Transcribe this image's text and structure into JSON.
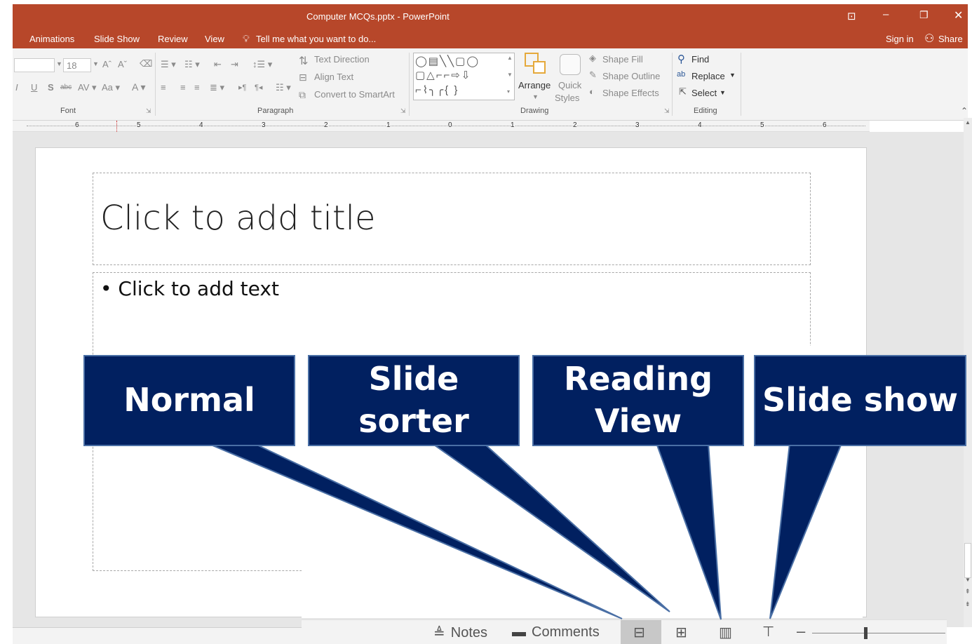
{
  "window": {
    "title": "Computer MCQs.pptx - PowerPoint",
    "sign_in": "Sign in",
    "share": "Share"
  },
  "tabs": [
    "Animations",
    "Slide Show",
    "Review",
    "View"
  ],
  "tell_me": "Tell me what you want to do...",
  "ribbon": {
    "font": {
      "size": "18",
      "group_label": "Font"
    },
    "paragraph": {
      "text_direction": "Text Direction",
      "align_text": "Align Text",
      "convert_smartart": "Convert to SmartArt",
      "group_label": "Paragraph"
    },
    "drawing": {
      "arrange": "Arrange",
      "quick_styles_1": "Quick",
      "quick_styles_2": "Styles",
      "shape_fill": "Shape Fill",
      "shape_outline": "Shape Outline",
      "shape_effects": "Shape Effects",
      "group_label": "Drawing"
    },
    "editing": {
      "find": "Find",
      "replace": "Replace",
      "select": "Select",
      "group_label": "Editing"
    }
  },
  "ruler_labels": [
    "6",
    "5",
    "4",
    "3",
    "2",
    "1",
    "0",
    "1",
    "2",
    "3",
    "4",
    "5",
    "6"
  ],
  "slide": {
    "title_placeholder": "Click to add title",
    "body_placeholder": "Click to add text"
  },
  "callouts": [
    {
      "label": "Normal"
    },
    {
      "label": "Slide sorter"
    },
    {
      "label": "Reading View"
    },
    {
      "label": "Slide show"
    }
  ],
  "statusbar": {
    "notes": "Notes",
    "comments": "Comments"
  },
  "colors": {
    "accent": "#b7472a",
    "callout_fill": "#012060"
  }
}
